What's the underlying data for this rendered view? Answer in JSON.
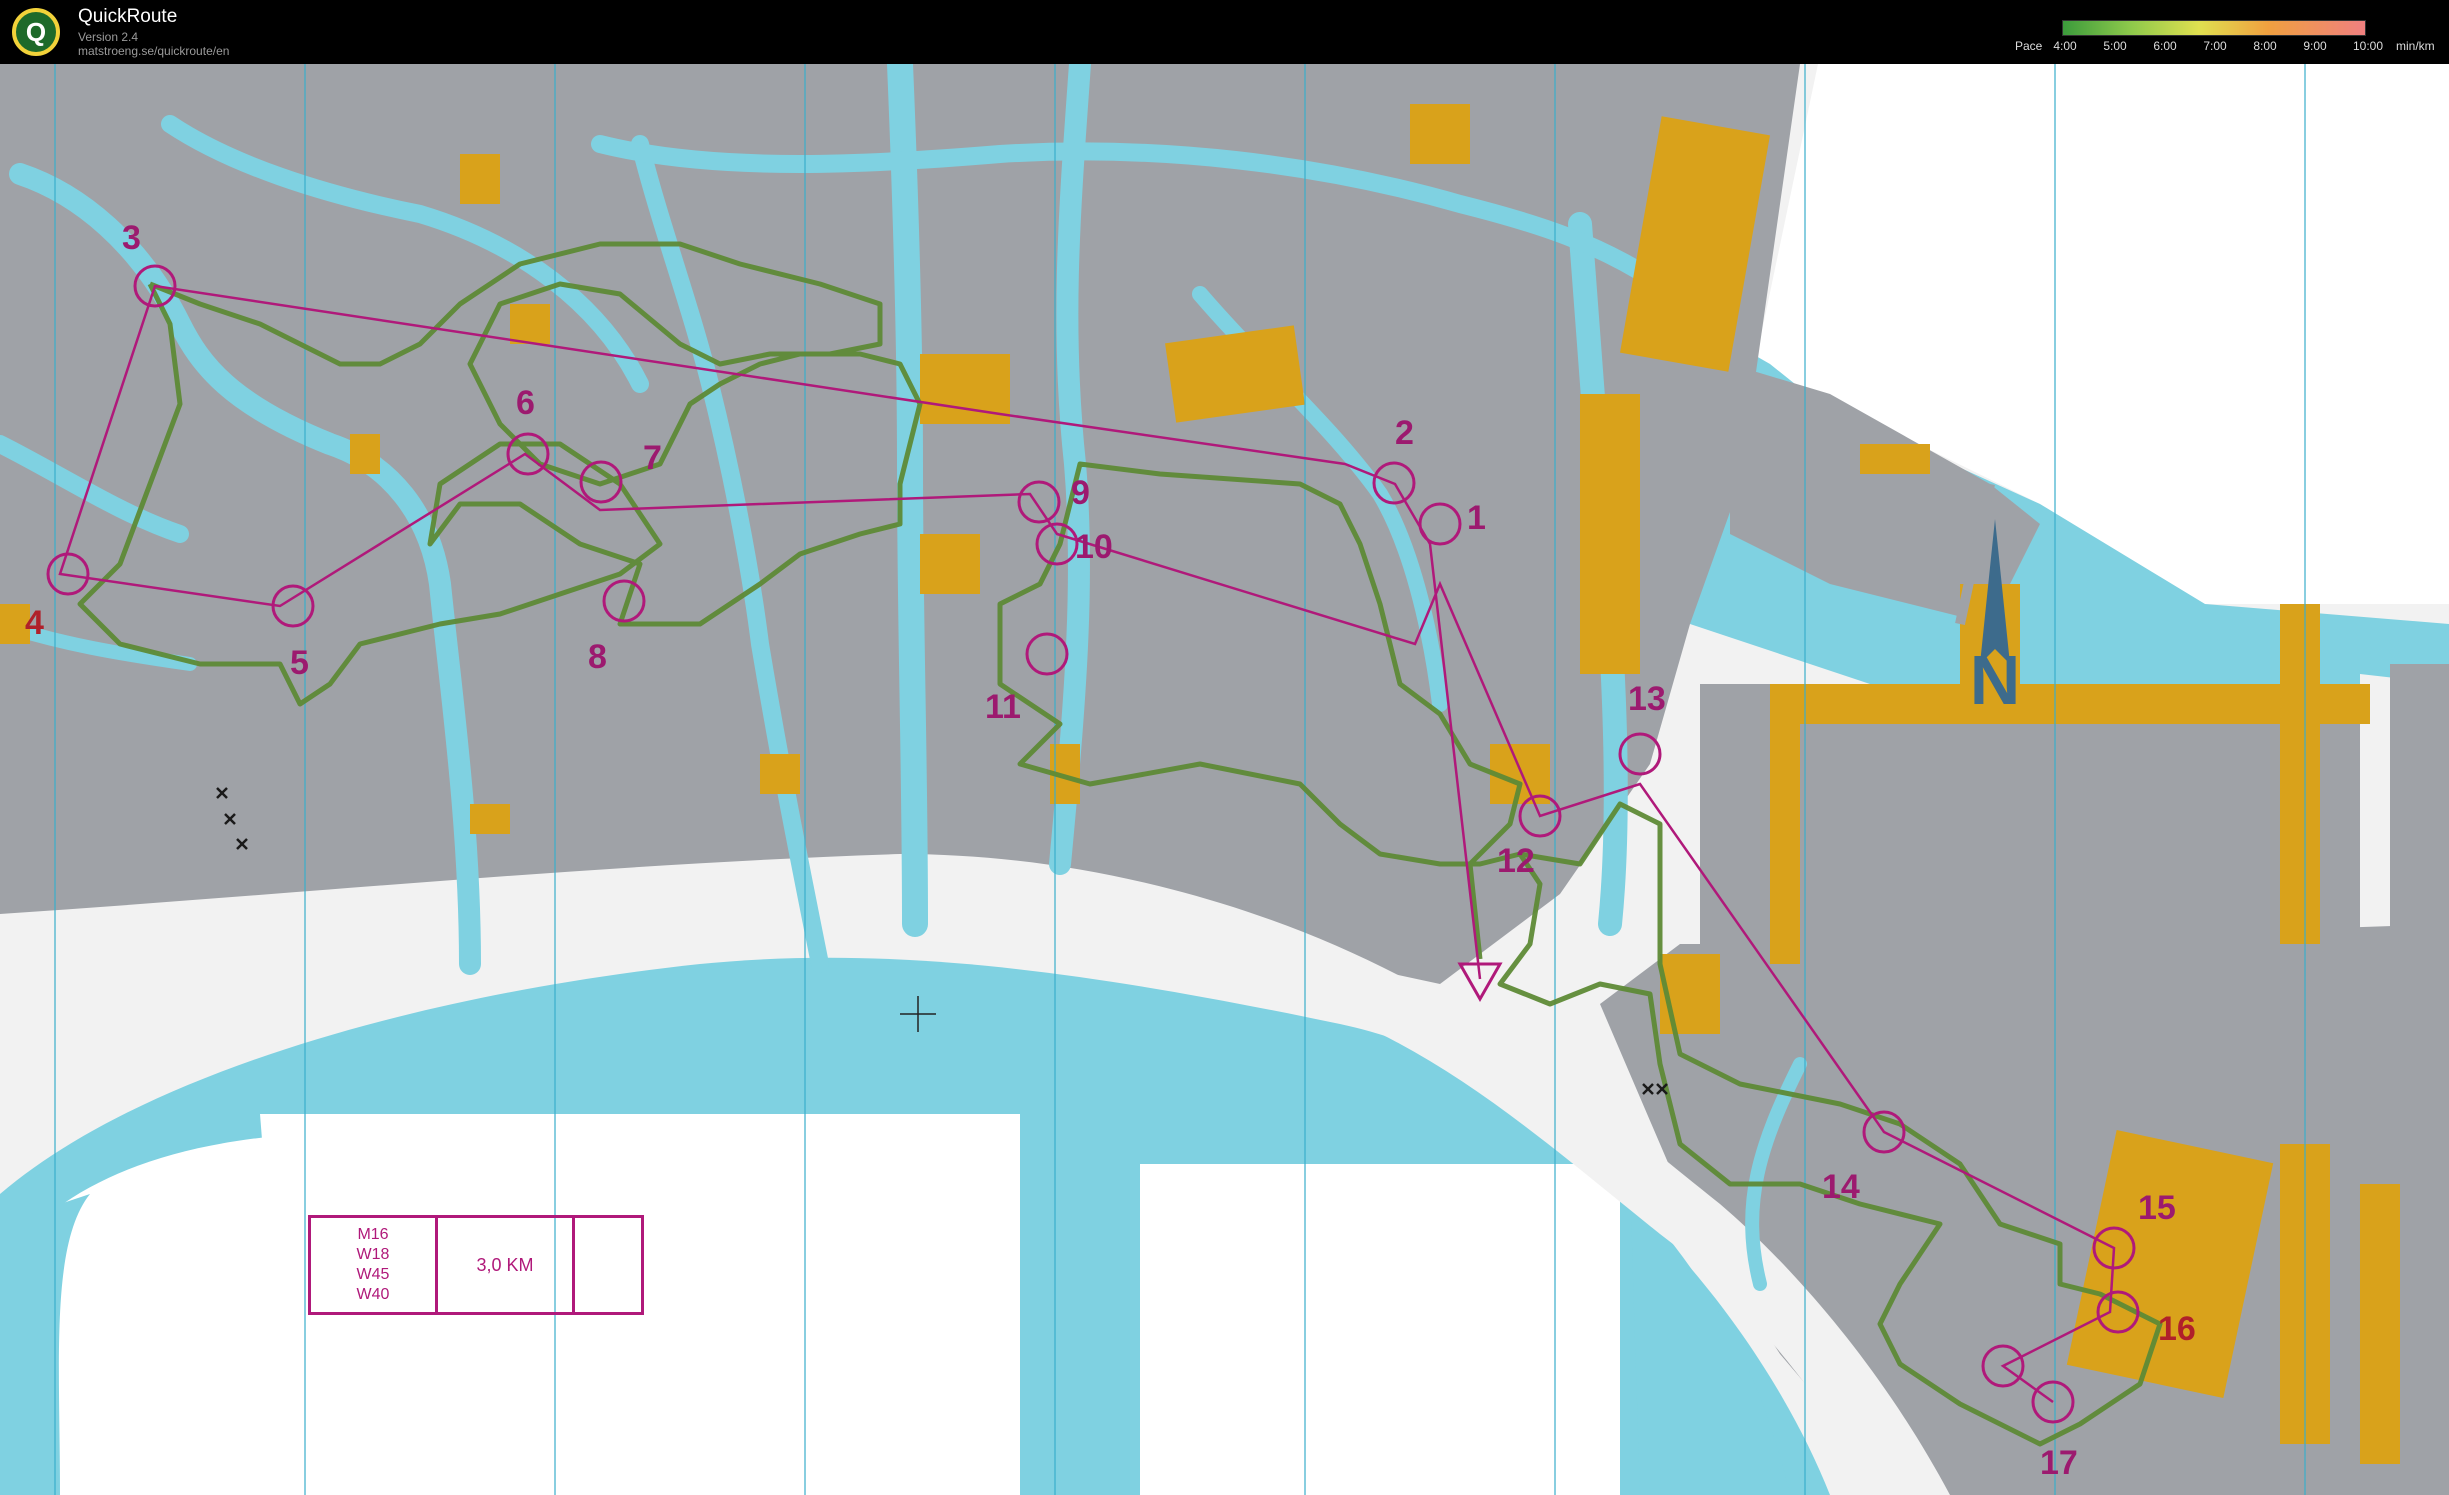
{
  "header": {
    "app_title": "QuickRoute",
    "version": "Version 2.4",
    "url": "matstroeng.se/quickroute/en"
  },
  "pace_legend": {
    "label": "Pace",
    "ticks": [
      "4:00",
      "5:00",
      "6:00",
      "7:00",
      "8:00",
      "9:00",
      "10:00"
    ],
    "unit": "min/km",
    "gradient_colors": [
      "#3c9b3c",
      "#8cc84b",
      "#e0e050",
      "#f0a040",
      "#f08080"
    ]
  },
  "map": {
    "colors": {
      "water": "#7fd1e1",
      "building": "#9fa2a7",
      "paved": "#f2f2f2",
      "yellow_area": "#d9a21b",
      "course": "#b0197a",
      "route": "#5e8a36"
    },
    "north_label": "N",
    "controls": [
      {
        "number": "1"
      },
      {
        "number": "2"
      },
      {
        "number": "3"
      },
      {
        "number": "4"
      },
      {
        "number": "5"
      },
      {
        "number": "6"
      },
      {
        "number": "7"
      },
      {
        "number": "8"
      },
      {
        "number": "9"
      },
      {
        "number": "10"
      },
      {
        "number": "11"
      },
      {
        "number": "12"
      },
      {
        "number": "13"
      },
      {
        "number": "14"
      },
      {
        "number": "15"
      },
      {
        "number": "16"
      },
      {
        "number": "17"
      }
    ],
    "course_info": {
      "classes": [
        "M16",
        "W18",
        "W45",
        "W40"
      ],
      "distance": "3,0 KM"
    }
  }
}
